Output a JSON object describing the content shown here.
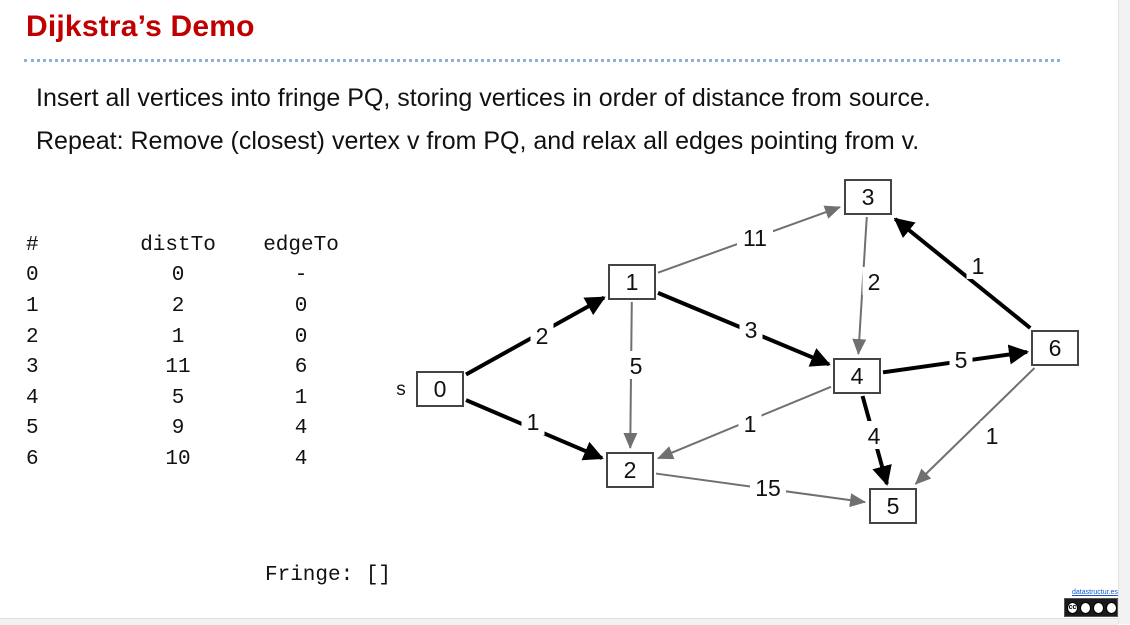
{
  "slide": {
    "title": "Dijkstra’s Demo",
    "bullets": [
      "Insert all vertices into fringe PQ, storing vertices in order of distance from source.",
      "Repeat: Remove (closest) vertex v from PQ, and relax all edges pointing from v."
    ]
  },
  "table": {
    "headers": [
      "#",
      "distTo",
      "edgeTo"
    ],
    "rows": [
      [
        "0",
        "0",
        "-"
      ],
      [
        "1",
        "2",
        "0"
      ],
      [
        "2",
        "1",
        "0"
      ],
      [
        "3",
        "11",
        "6"
      ],
      [
        "4",
        "5",
        "1"
      ],
      [
        "5",
        "9",
        "4"
      ],
      [
        "6",
        "10",
        "4"
      ]
    ]
  },
  "fringe": {
    "text": "Fringe: []"
  },
  "graph": {
    "source_marker": "s",
    "nodes": [
      "0",
      "1",
      "2",
      "3",
      "4",
      "5",
      "6"
    ],
    "edges": [
      {
        "from": "0",
        "to": "1",
        "weight": "2",
        "bold": true
      },
      {
        "from": "0",
        "to": "2",
        "weight": "1",
        "bold": true
      },
      {
        "from": "1",
        "to": "3",
        "weight": "11",
        "bold": false
      },
      {
        "from": "1",
        "to": "4",
        "weight": "3",
        "bold": true
      },
      {
        "from": "1",
        "to": "2",
        "weight": "5",
        "bold": false
      },
      {
        "from": "3",
        "to": "4",
        "weight": "2",
        "bold": false
      },
      {
        "from": "6",
        "to": "3",
        "weight": "1",
        "bold": true
      },
      {
        "from": "4",
        "to": "6",
        "weight": "5",
        "bold": true
      },
      {
        "from": "4",
        "to": "2",
        "weight": "1",
        "bold": false
      },
      {
        "from": "4",
        "to": "5",
        "weight": "4",
        "bold": true
      },
      {
        "from": "2",
        "to": "5",
        "weight": "15",
        "bold": false
      },
      {
        "from": "6",
        "to": "5",
        "weight": "1",
        "bold": false
      }
    ]
  },
  "footer": {
    "link_text": "datastructur.es",
    "license_badge": [
      "cc",
      "by",
      "nc",
      "sa"
    ]
  },
  "colors": {
    "title": "#c00000",
    "rule": "#8fb1d6",
    "bold_edge": "#000000",
    "light_edge": "#707070"
  }
}
